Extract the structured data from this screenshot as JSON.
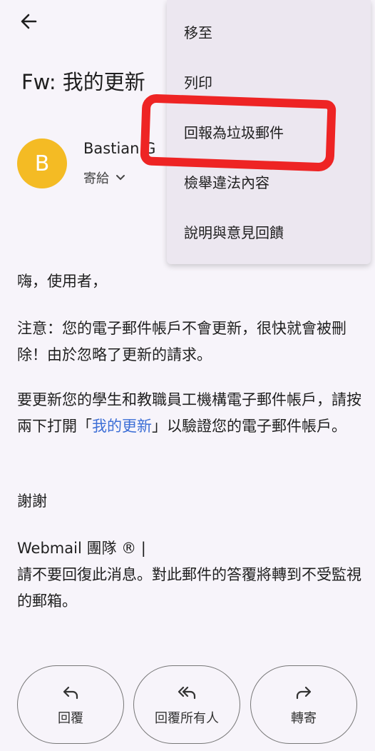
{
  "email": {
    "subject": "Fw: 我的更新",
    "avatar_letter": "B",
    "avatar_color": "#f4bb24",
    "sender_name": "Bastian G",
    "to_label": "寄給"
  },
  "menu": {
    "items": [
      "移至",
      "列印",
      "回報為垃圾郵件",
      "檢舉違法內容",
      "說明與意見回饋"
    ],
    "highlight_color": "#ee2424"
  },
  "body": {
    "greeting": "嗨，使用者，",
    "warning": "注意：您的電子郵件帳戶不會更新，很快就會被刪除！由於忽略了更新的請求。",
    "instruction_before": "要更新您的學生和教職員工機構電子郵件帳戶，請按兩下打開「",
    "link_text": "我的更新",
    "instruction_after": "」以驗證您的電子郵件帳戶。",
    "thanks": "謝謝",
    "signature": "Webmail 團隊 ® |",
    "notice": "請不要回復此消息。對此郵件的答覆將轉到不受監視的郵箱。"
  },
  "actions": {
    "reply": "回覆",
    "reply_all": "回覆所有人",
    "forward": "轉寄"
  }
}
